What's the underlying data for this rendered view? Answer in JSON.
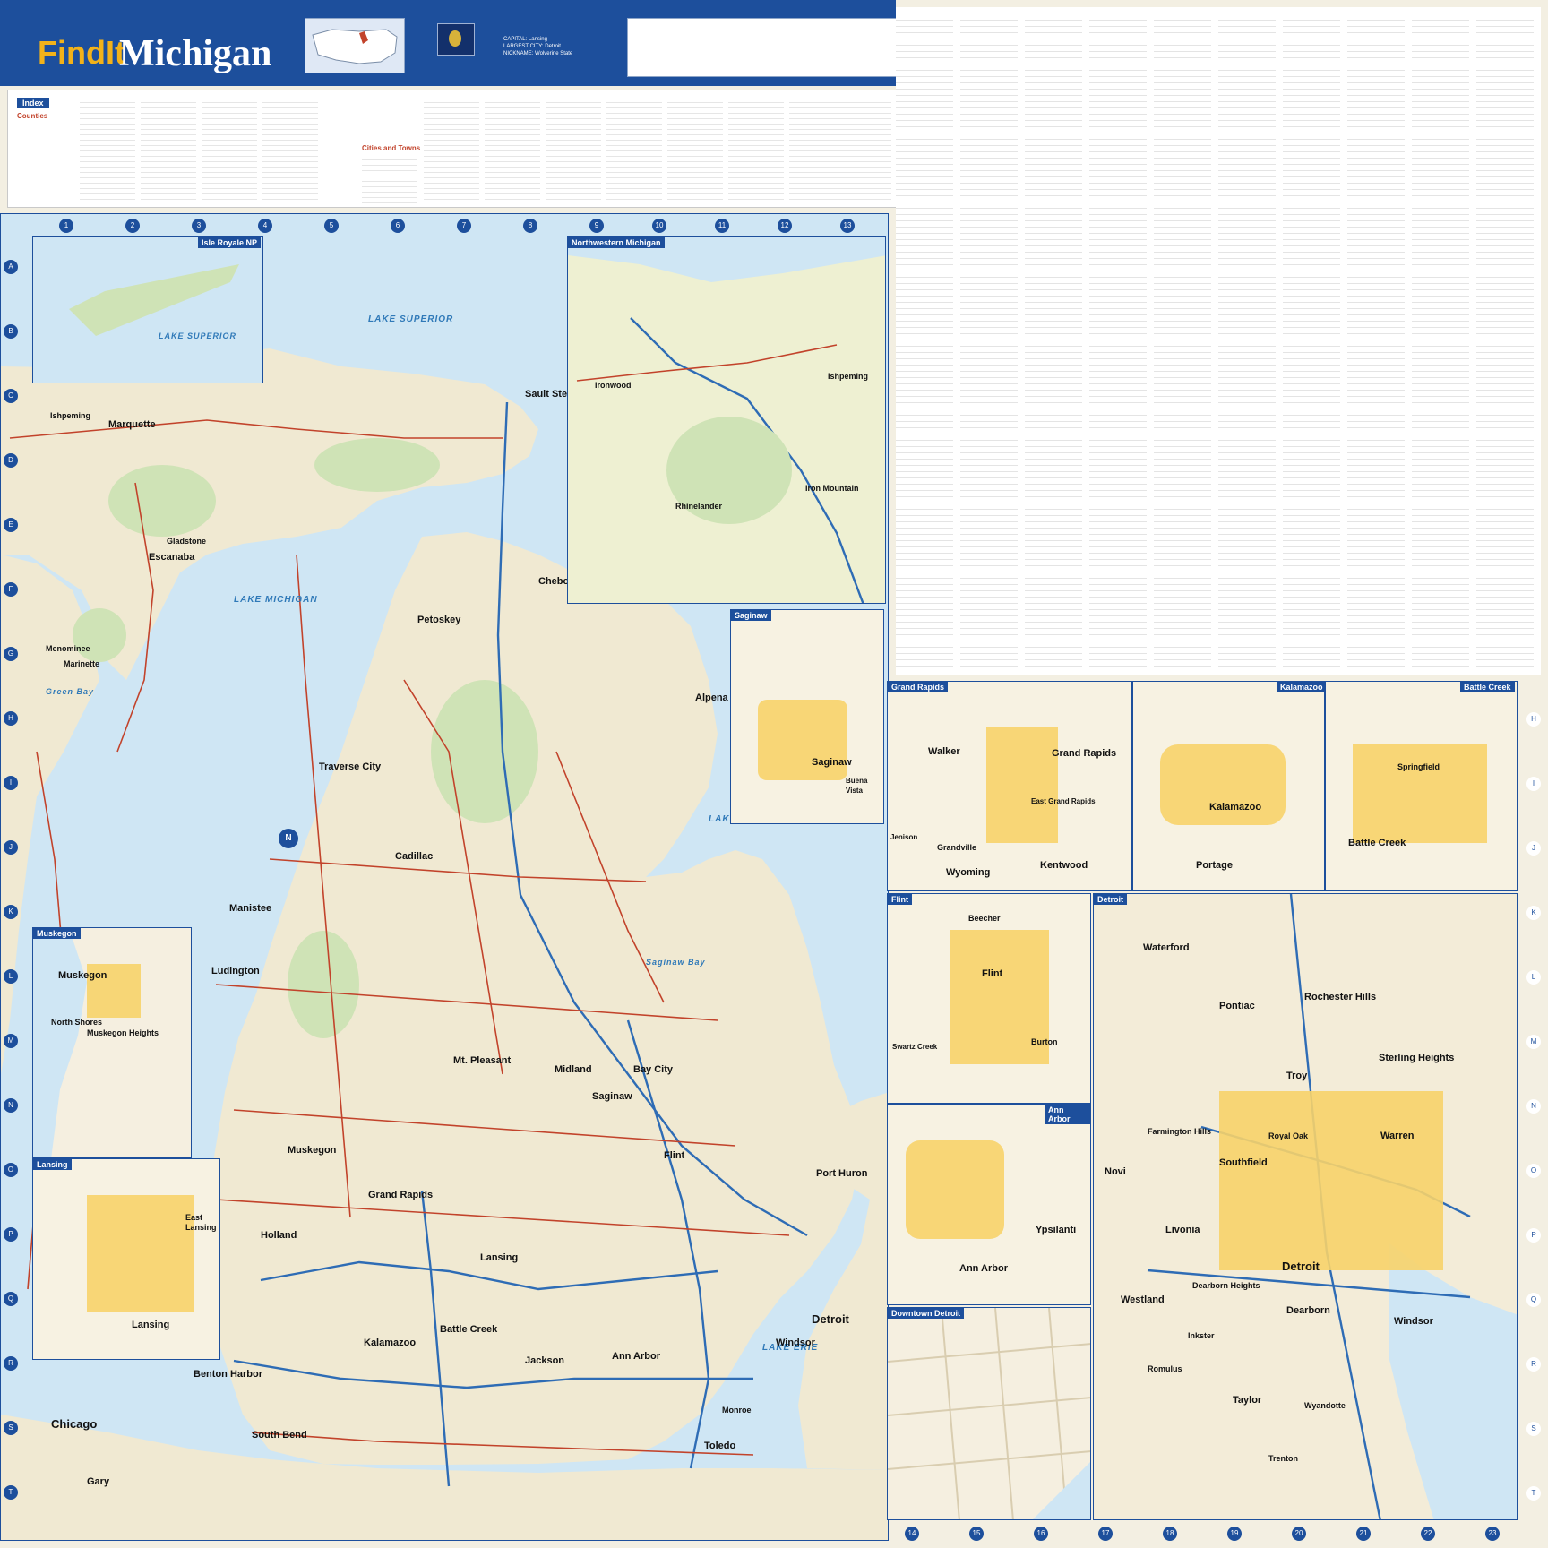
{
  "header": {
    "brand_prefix": "FindIt",
    "title": "Michigan",
    "facts": [
      {
        "label": "CAPITAL:",
        "value": "Lansing"
      },
      {
        "label": "LARGEST CITY:",
        "value": "Detroit"
      },
      {
        "label": "NICKNAME:",
        "value": "Wolverine State"
      }
    ]
  },
  "index": {
    "title": "Index",
    "subtitle_counties": "Counties",
    "subtitle_cities": "Cities and Towns"
  },
  "grid": {
    "columns_top": [
      "1",
      "2",
      "3",
      "4",
      "5",
      "6",
      "7",
      "8",
      "9",
      "10",
      "11",
      "12",
      "13"
    ],
    "rows_left": [
      "A",
      "B",
      "C",
      "D",
      "E",
      "F",
      "G",
      "H",
      "I",
      "J",
      "K",
      "L",
      "M",
      "N",
      "O",
      "P",
      "Q",
      "R",
      "S",
      "T"
    ],
    "rows_right": [
      "H",
      "I",
      "J",
      "K",
      "L",
      "M",
      "N",
      "O",
      "P",
      "Q",
      "R",
      "S",
      "T"
    ],
    "columns_bottom": [
      "14",
      "15",
      "16",
      "17",
      "18",
      "19",
      "20",
      "21",
      "22",
      "23"
    ]
  },
  "insets": {
    "isle_royale": "Isle Royale NP",
    "northwestern": "Northwestern Michigan",
    "saginaw": "Saginaw",
    "grand_rapids": "Grand Rapids",
    "kalamazoo": "Kalamazoo",
    "battle_creek": "Battle Creek",
    "flint": "Flint",
    "detroit": "Detroit",
    "ann_arbor": "Ann Arbor",
    "downtown_detroit": "Downtown Detroit",
    "muskegon": "Muskegon",
    "lansing": "Lansing"
  },
  "water_labels": {
    "lake_superior": "LAKE SUPERIOR",
    "lake_michigan": "LAKE MICHIGAN",
    "lake_huron": "LAKE HURON",
    "lake_erie": "LAKE ERIE",
    "green_bay": "Green Bay",
    "saginaw_bay": "Saginaw Bay"
  },
  "main_cities": [
    {
      "name": "Sault Ste. Marie"
    },
    {
      "name": "Marquette"
    },
    {
      "name": "Escanaba"
    },
    {
      "name": "Gladstone"
    },
    {
      "name": "Ishpeming"
    },
    {
      "name": "Menominee"
    },
    {
      "name": "Marinette"
    },
    {
      "name": "Petoskey"
    },
    {
      "name": "Cheboygan"
    },
    {
      "name": "Alpena"
    },
    {
      "name": "Traverse City"
    },
    {
      "name": "Cadillac"
    },
    {
      "name": "Manistee"
    },
    {
      "name": "Ludington"
    },
    {
      "name": "Mt. Pleasant"
    },
    {
      "name": "Midland"
    },
    {
      "name": "Bay City"
    },
    {
      "name": "Saginaw"
    },
    {
      "name": "Flint"
    },
    {
      "name": "Port Huron"
    },
    {
      "name": "Muskegon"
    },
    {
      "name": "Grand Rapids"
    },
    {
      "name": "Holland"
    },
    {
      "name": "Lansing"
    },
    {
      "name": "Jackson"
    },
    {
      "name": "Ann Arbor"
    },
    {
      "name": "Detroit"
    },
    {
      "name": "Windsor"
    },
    {
      "name": "Kalamazoo"
    },
    {
      "name": "Battle Creek"
    },
    {
      "name": "Benton Harbor"
    },
    {
      "name": "South Bend"
    },
    {
      "name": "Toledo"
    },
    {
      "name": "Chicago"
    },
    {
      "name": "Gary"
    },
    {
      "name": "Monroe"
    }
  ],
  "inset_cities": {
    "grand_rapids": [
      "Grand Rapids",
      "Walker",
      "Wyoming",
      "Kentwood",
      "East Grand Rapids",
      "Grandville",
      "Jenison"
    ],
    "kalamazoo": [
      "Kalamazoo",
      "Portage"
    ],
    "battle_creek": [
      "Springfield",
      "Battle Creek"
    ],
    "flint": [
      "Flint",
      "Beecher",
      "Burton",
      "Swartz Creek"
    ],
    "detroit": [
      "Waterford",
      "Pontiac",
      "Rochester Hills",
      "Sterling Heights",
      "Troy",
      "Warren",
      "Livonia",
      "Dearborn",
      "Detroit",
      "Southfield",
      "Windsor",
      "Taylor",
      "Novi",
      "Westland",
      "Royal Oak",
      "Farmington Hills",
      "Dearborn Heights",
      "Inkster",
      "Romulus",
      "Wyandotte",
      "Trenton"
    ],
    "ann_arbor": [
      "Ann Arbor",
      "Ypsilanti"
    ],
    "muskegon": [
      "Muskegon",
      "North Shores",
      "Muskegon Heights"
    ],
    "lansing": [
      "Lansing",
      "East Lansing"
    ],
    "saginaw": [
      "Saginaw",
      "Buena Vista"
    ],
    "northwestern": [
      "Ironwood",
      "Iron Mountain",
      "Rhinelander",
      "Ishpeming"
    ]
  },
  "colors": {
    "brand_blue": "#1d4f9c",
    "brand_gold": "#f2b21a",
    "water": "#cfe6f4",
    "land": "#f0e9d2",
    "urban": "#f7d36a",
    "interstate": "#2e6cb5",
    "highway": "#c2432b"
  },
  "icons": {
    "compass": "compass-rose-icon",
    "flag": "michigan-flag-icon",
    "locator": "us-locator-map-icon"
  }
}
